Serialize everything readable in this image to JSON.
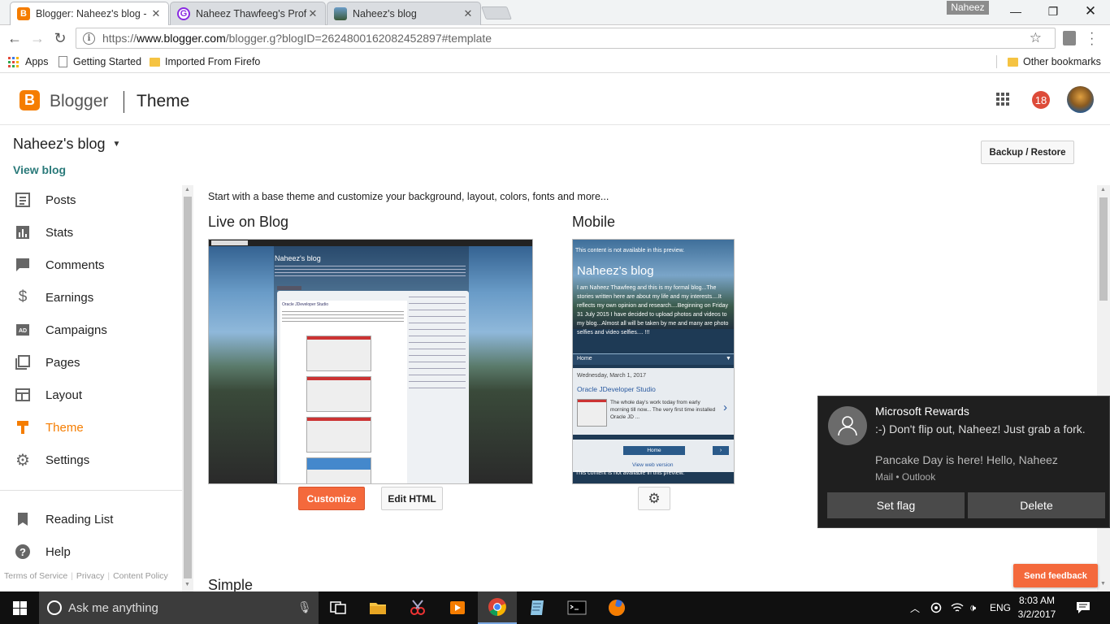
{
  "browser": {
    "tabs": [
      {
        "title": "Blogger: Naheez's blog -",
        "icon": "blogger-favicon",
        "active": true
      },
      {
        "title": "Naheez Thawfeeg's Profil",
        "icon": "profile-favicon",
        "active": false
      },
      {
        "title": "Naheez's blog",
        "icon": "blog-favicon",
        "active": false
      }
    ],
    "profile_name": "Naheez",
    "url_prefix": "https://",
    "url_domain": "www.blogger.com",
    "url_path": "/blogger.g?blogID=2624800162082452897#template",
    "bookmarks": {
      "apps": "Apps",
      "getting_started": "Getting Started",
      "imported": "Imported From Firefo",
      "other": "Other bookmarks"
    }
  },
  "header": {
    "logo_letter": "B",
    "brand": "Blogger",
    "section": "Theme",
    "notification_count": "18"
  },
  "sidebar": {
    "blog_title": "Naheez's blog",
    "view_blog": "View blog",
    "items": [
      {
        "label": "Posts",
        "icon": "posts-icon"
      },
      {
        "label": "Stats",
        "icon": "stats-icon"
      },
      {
        "label": "Comments",
        "icon": "comments-icon"
      },
      {
        "label": "Earnings",
        "icon": "dollar-icon"
      },
      {
        "label": "Campaigns",
        "icon": "ad-icon"
      },
      {
        "label": "Pages",
        "icon": "pages-icon"
      },
      {
        "label": "Layout",
        "icon": "layout-icon"
      },
      {
        "label": "Theme",
        "icon": "theme-icon",
        "active": true
      },
      {
        "label": "Settings",
        "icon": "gear-icon"
      }
    ],
    "secondary": [
      {
        "label": "Reading List",
        "icon": "bookmark-icon"
      },
      {
        "label": "Help",
        "icon": "help-icon"
      }
    ],
    "footer": {
      "terms": "Terms of Service",
      "privacy": "Privacy",
      "content_policy": "Content Policy"
    }
  },
  "main": {
    "backup_label": "Backup / Restore",
    "intro": "Start with a base theme and customize your background, layout, colors, fonts and more...",
    "live_heading": "Live on Blog",
    "mobile_heading": "Mobile",
    "customize_label": "Customize",
    "edit_html_label": "Edit HTML",
    "simple_heading": "Simple",
    "desktop_preview": {
      "blog_title": "Naheez's blog",
      "post_title": "Oracle JDeveloper Studio"
    },
    "mobile_preview": {
      "notice": "This content is not available in this preview.",
      "blog_title": "Naheez's blog",
      "description": "I am Naheez Thawfeeg and this is my formal blog...The stories written here are about my life and my interests....It reflects my own opinion and research....Beginning on Friday 31 July 2015 I have decided to upload photos and videos to my blog...Almost all will be taken by me and many are photo selfies and video selfies.... !!!",
      "home": "Home",
      "date": "Wednesday, March 1, 2017",
      "post_title": "Oracle JDeveloper Studio",
      "post_snippet": "The whole day's work today from early morning till now... The very first time installed Oracle JD ...",
      "home_button": "Home",
      "view_web": "View web version",
      "notice_bottom": "This content is not available in this preview."
    },
    "feedback_label": "Send feedback"
  },
  "toast": {
    "app": "Microsoft Rewards",
    "line1": ":-) Don't flip out, Naheez! Just grab a fork.",
    "line2": "Pancake Day is here! Hello, Naheez",
    "source": "Mail • Outlook",
    "btn_flag": "Set flag",
    "btn_delete": "Delete"
  },
  "taskbar": {
    "search_placeholder": "Ask me anything",
    "lang": "ENG",
    "time": "8:03 AM",
    "date": "3/2/2017"
  }
}
